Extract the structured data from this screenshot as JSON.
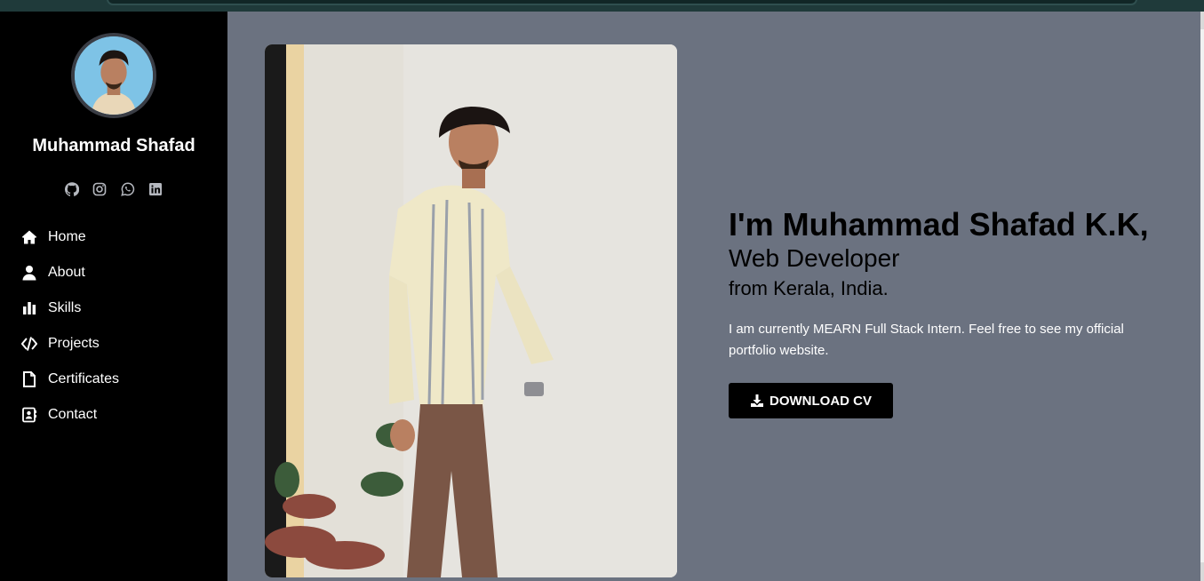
{
  "sidebar": {
    "name": "Muhammad Shafad",
    "socials": [
      {
        "icon": "github-icon"
      },
      {
        "icon": "instagram-icon"
      },
      {
        "icon": "whatsapp-icon"
      },
      {
        "icon": "linkedin-icon"
      }
    ],
    "nav": [
      {
        "label": "Home",
        "icon": "home-icon"
      },
      {
        "label": "About",
        "icon": "user-icon"
      },
      {
        "label": "Skills",
        "icon": "chart-icon"
      },
      {
        "label": "Projects",
        "icon": "code-icon"
      },
      {
        "label": "Certificates",
        "icon": "file-icon"
      },
      {
        "label": "Contact",
        "icon": "contact-card-icon"
      }
    ]
  },
  "hero": {
    "heading": "I'm Muhammad Shafad K.K,",
    "role": "Web Developer",
    "location": "from Kerala, India.",
    "description": "I am currently MEARN Full Stack Intern. Feel free to see my official portfolio website.",
    "cv_button": "DOWNLOAD CV"
  },
  "colors": {
    "sidebar_bg": "#000000",
    "main_bg": "#6b7280",
    "button_bg": "#000000"
  }
}
